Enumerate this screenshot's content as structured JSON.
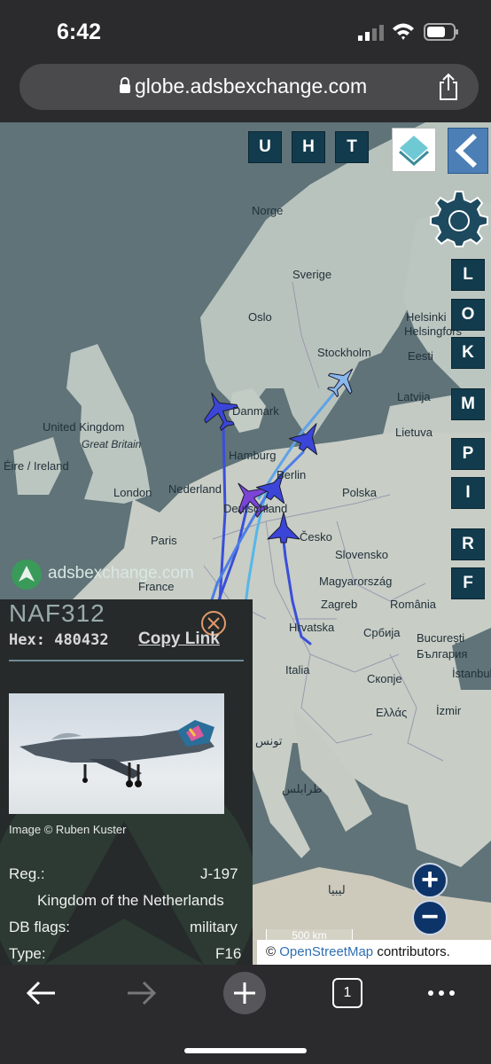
{
  "status_bar": {
    "time": "6:42"
  },
  "browser": {
    "url": "globe.adsbexchange.com"
  },
  "map_controls": {
    "top_buttons": [
      "U",
      "H",
      "T"
    ],
    "side_buttons": [
      "L",
      "O",
      "K",
      "M",
      "P",
      "I",
      "R",
      "F"
    ],
    "zoom_in": "+",
    "zoom_out": "−",
    "scale": "500 km",
    "attribution_prefix": "©",
    "attribution_link": "OpenStreetMap",
    "attribution_suffix": "contributors."
  },
  "brand": {
    "name": "adsbexchange.com"
  },
  "map_labels": {
    "norge": "Norge",
    "sverige": "Sverige",
    "oslo": "Oslo",
    "stockholm": "Stockholm",
    "helsinki": "Helsinki",
    "helsingfors": "Helsingfors",
    "eesti": "Eesti",
    "latvija": "Latvija",
    "lietuva": "Lietuva",
    "danmark": "Danmark",
    "united_kingdom": "United Kingdom",
    "great_britain": "Great Britain",
    "eire": "Éire / Ireland",
    "london": "London",
    "nederland": "Nederland",
    "hamburg": "Hamburg",
    "berlin": "Berlin",
    "polska": "Polska",
    "deutschland": "Deutschland",
    "paris": "Paris",
    "france": "France",
    "cesko": "Česko",
    "slovensko": "Slovensko",
    "magyarorszag": "Magyarország",
    "zagreb": "Zagreb",
    "hrvatska": "Hrvatska",
    "srbija": "Србија",
    "romania": "România",
    "bucuresti": "București",
    "bulgaria": "България",
    "italia": "Italia",
    "skopje": "Скопје",
    "istanbul": "İstanbul",
    "ellas": "Ελλάς",
    "izmir": "İzmir",
    "tunisia": "تونس",
    "tripoli": "طرابلس",
    "libya": "ليبيا"
  },
  "aircraft": {
    "callsign": "NAF312",
    "hex_label": "Hex:",
    "hex": "480432",
    "copy_link": "Copy Link",
    "image_credit": "Image © Ruben Kuster",
    "reg_label": "Reg.:",
    "reg": "J-197",
    "country": "Kingdom of the Netherlands",
    "db_flags_label": "DB flags:",
    "db_flags": "military",
    "type_label": "Type:",
    "type": "F16"
  },
  "browser_toolbar": {
    "tab_count": "1"
  },
  "colors": {
    "track_blue": "#3a4fd9",
    "track_cyan": "#56b7e8",
    "panel_bg": "#262a2a",
    "button_bg": "#123b4d"
  }
}
